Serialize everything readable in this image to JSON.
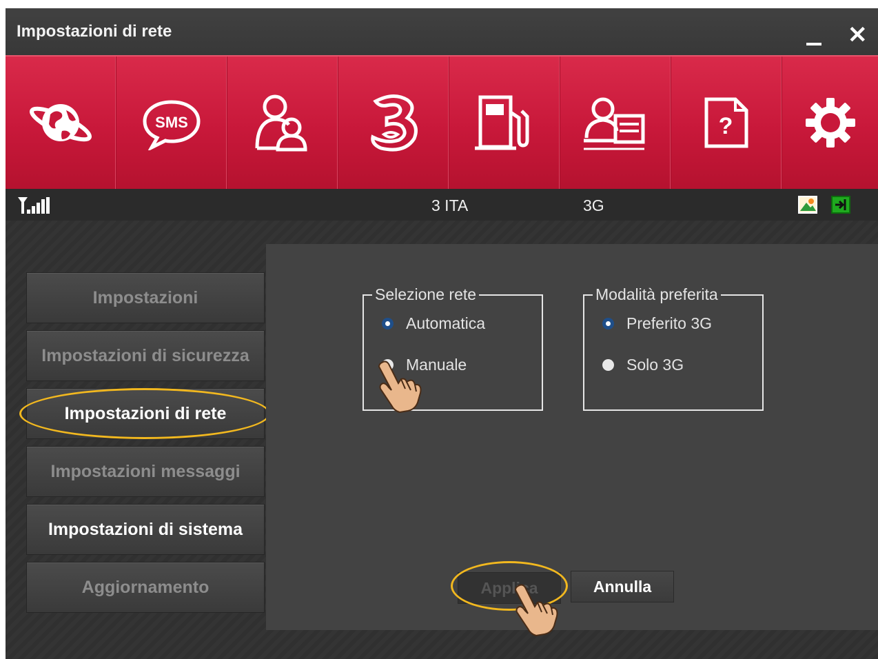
{
  "window": {
    "title": "Impostazioni di rete",
    "minimize_label": "_",
    "close_label": "✕"
  },
  "toolbar": {
    "items": [
      {
        "icon": "globe-icon",
        "label": ""
      },
      {
        "icon": "sms-icon",
        "label": "SMS"
      },
      {
        "icon": "contacts-icon",
        "label": ""
      },
      {
        "icon": "three-logo-icon",
        "label": ""
      },
      {
        "icon": "fuel-pump-icon",
        "label": ""
      },
      {
        "icon": "user-card-icon",
        "label": ""
      },
      {
        "icon": "help-document-icon",
        "label": "?"
      },
      {
        "icon": "gear-icon",
        "label": ""
      }
    ]
  },
  "status": {
    "signal_icon": "signal-strength-icon",
    "operator": "3 ITA",
    "network": "3G",
    "right_icons": [
      "image-icon",
      "connect-icon"
    ]
  },
  "sidebar": {
    "items": [
      {
        "label": "Impostazioni",
        "state": "normal"
      },
      {
        "label": "Impostazioni di sicurezza",
        "state": "normal"
      },
      {
        "label": "Impostazioni di rete",
        "state": "active"
      },
      {
        "label": "Impostazioni messaggi",
        "state": "normal"
      },
      {
        "label": "Impostazioni di sistema",
        "state": "bright"
      },
      {
        "label": "Aggiornamento",
        "state": "normal"
      }
    ]
  },
  "network_selection": {
    "legend": "Selezione rete",
    "options": [
      {
        "label": "Automatica",
        "checked": true
      },
      {
        "label": "Manuale",
        "checked": false
      }
    ]
  },
  "preferred_mode": {
    "legend": "Modalità preferita",
    "options": [
      {
        "label": "Preferito 3G",
        "checked": true
      },
      {
        "label": "Solo 3G",
        "checked": false
      }
    ]
  },
  "actions": {
    "apply_label": "Applica",
    "cancel_label": "Annulla"
  },
  "colors": {
    "accent_red": "#c8183a",
    "highlight_yellow": "#f2b81f",
    "radio_checked": "#1f4f8a",
    "status_green": "#2ea82e"
  }
}
